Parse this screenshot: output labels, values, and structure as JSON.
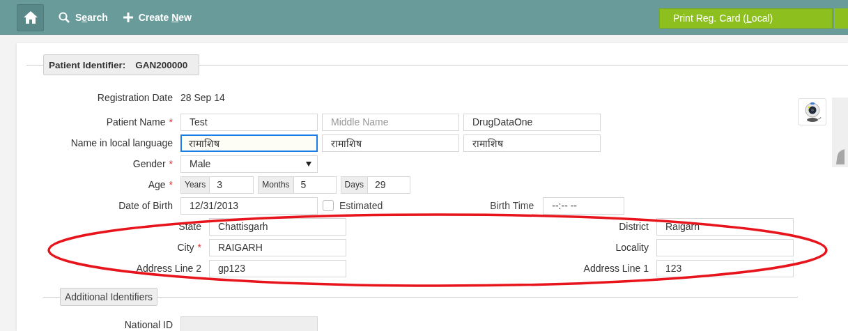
{
  "toolbar": {
    "items": [
      {
        "kind": "home"
      },
      {
        "kind": "search",
        "label": [
          "S",
          "e",
          "arch"
        ]
      },
      {
        "kind": "create",
        "label": [
          "Create ",
          "N",
          "ew"
        ]
      }
    ],
    "print_button": {
      "label": [
        "Print Reg. Card (",
        "L",
        "ocal)"
      ]
    }
  },
  "identifier": {
    "label": "Patient Identifier:",
    "value": "GAN200000"
  },
  "rows": [
    {
      "kind": "text",
      "label": "Registration Date",
      "value": "28 Sep 14"
    },
    {
      "kind": "inputs",
      "label": "Patient Name",
      "required_mark": "*",
      "inputs": [
        {
          "value": "Test",
          "focused": false
        },
        {
          "placeholder": "Middle Name",
          "focused": false
        },
        {
          "value": "DrugDataOne",
          "focused": false
        }
      ]
    },
    {
      "kind": "inputs",
      "label": "Name in local language",
      "inputs": [
        {
          "value": "रामाशिष",
          "focused": true
        },
        {
          "value": "रामाशिष",
          "focused": false
        },
        {
          "value": "रामाशिष",
          "focused": false
        }
      ]
    },
    {
      "kind": "select",
      "label": "Gender",
      "required_mark": "*",
      "value": "Male"
    },
    {
      "kind": "age",
      "label": "Age",
      "required_mark": "*",
      "parts": [
        {
          "unit": "Years",
          "value": "3"
        },
        {
          "unit": "Months",
          "value": "5"
        },
        {
          "unit": "Days",
          "value": "29"
        }
      ]
    },
    {
      "kind": "dob",
      "label": "Date of Birth",
      "value": "12/31/2013",
      "estimated": {
        "label": "Estimated",
        "checked": false
      },
      "birth_time": {
        "label": "Birth Time",
        "value": "--:-- --"
      }
    }
  ],
  "address": [
    [
      {
        "label": "State",
        "value": "Chattisgarh"
      },
      {
        "label": "District",
        "value": "Raigarh"
      }
    ],
    [
      {
        "label": "City",
        "required_mark": "*",
        "value": "RAIGARH"
      },
      {
        "label": "Locality"
      }
    ],
    [
      {
        "label": "Address Line 2",
        "value": "gp123"
      },
      {
        "label": "Address Line 1",
        "value": "123"
      }
    ]
  ],
  "additional": {
    "label": "Additional Identifiers",
    "rows": [
      {
        "label": "National ID",
        "disabled": true
      }
    ]
  }
}
